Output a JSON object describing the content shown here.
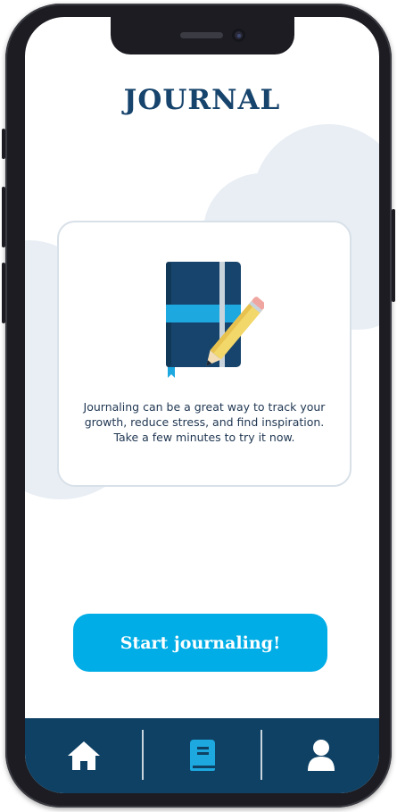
{
  "app": {
    "title": "JOURNAL"
  },
  "card": {
    "illustration": "journal-notebook-pencil",
    "description": "Journaling can be a great way to track your growth, reduce stress, and find inspiration. Take a few minutes to try it now."
  },
  "cta": {
    "label": "Start journaling!"
  },
  "tabbar": {
    "items": [
      {
        "name": "home",
        "icon": "home-icon",
        "active": false
      },
      {
        "name": "journal",
        "icon": "journal-book-icon",
        "active": true
      },
      {
        "name": "profile",
        "icon": "person-icon",
        "active": false
      }
    ]
  },
  "colors": {
    "brand_dark": "#17446c",
    "accent": "#00ade6",
    "tabbar": "#0e4164",
    "cloud": "#e8eef4"
  }
}
